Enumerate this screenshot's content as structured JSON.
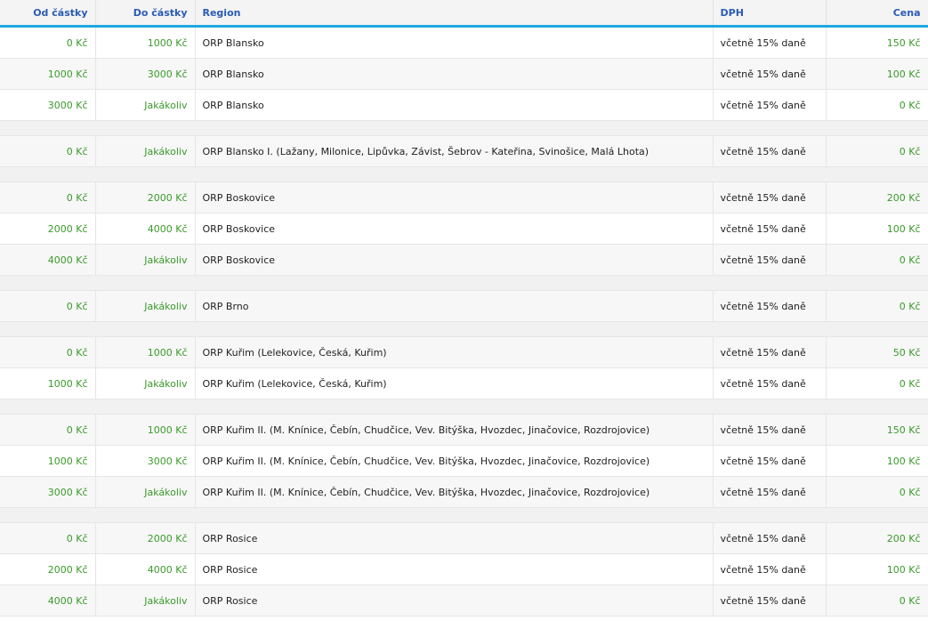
{
  "headers": [
    "Od částky",
    "Do částky",
    "Region",
    "DPH",
    "Cena"
  ],
  "rows": [
    {
      "from": "0 Kč",
      "to": "1000 Kč",
      "region": "ORP Blansko",
      "vat": "včetně 15% daně",
      "price": "150 Kč"
    },
    {
      "from": "1000 Kč",
      "to": "3000 Kč",
      "region": "ORP Blansko",
      "vat": "včetně 15% daně",
      "price": "100 Kč"
    },
    {
      "from": "3000 Kč",
      "to": "Jakákoliv",
      "region": "ORP Blansko",
      "vat": "včetně 15% daně",
      "price": "0 Kč"
    },
    {
      "separator": true
    },
    {
      "from": "0 Kč",
      "to": "Jakákoliv",
      "region": "ORP Blansko I. (Lažany, Milonice, Lipůvka, Závist, Šebrov - Kateřina, Svinošice, Malá Lhota)",
      "vat": "včetně 15% daně",
      "price": "0 Kč"
    },
    {
      "separator": true
    },
    {
      "from": "0 Kč",
      "to": "2000 Kč",
      "region": "ORP Boskovice",
      "vat": "včetně 15% daně",
      "price": "200 Kč"
    },
    {
      "from": "2000 Kč",
      "to": "4000 Kč",
      "region": "ORP Boskovice",
      "vat": "včetně 15% daně",
      "price": "100 Kč"
    },
    {
      "from": "4000 Kč",
      "to": "Jakákoliv",
      "region": "ORP Boskovice",
      "vat": "včetně 15% daně",
      "price": "0 Kč"
    },
    {
      "separator": true
    },
    {
      "from": "0 Kč",
      "to": "Jakákoliv",
      "region": "ORP Brno",
      "vat": "včetně 15% daně",
      "price": "0 Kč"
    },
    {
      "separator": true
    },
    {
      "from": "0 Kč",
      "to": "1000 Kč",
      "region": "ORP Kuřim (Lelekovice, Česká, Kuřim)",
      "vat": "včetně 15% daně",
      "price": "50 Kč"
    },
    {
      "from": "1000 Kč",
      "to": "Jakákoliv",
      "region": "ORP Kuřim (Lelekovice, Česká, Kuřim)",
      "vat": "včetně 15% daně",
      "price": "0 Kč"
    },
    {
      "separator": true
    },
    {
      "from": "0 Kč",
      "to": "1000 Kč",
      "region": "ORP Kuřim II. (M. Knínice, Čebín, Chudčice, Vev. Bitýška, Hvozdec, Jinačovice, Rozdrojovice)",
      "vat": "včetně 15% daně",
      "price": "150 Kč"
    },
    {
      "from": "1000 Kč",
      "to": "3000 Kč",
      "region": "ORP Kuřim II. (M. Knínice, Čebín, Chudčice, Vev. Bitýška, Hvozdec, Jinačovice, Rozdrojovice)",
      "vat": "včetně 15% daně",
      "price": "100 Kč"
    },
    {
      "from": "3000 Kč",
      "to": "Jakákoliv",
      "region": "ORP Kuřim II. (M. Knínice, Čebín, Chudčice, Vev. Bitýška, Hvozdec, Jinačovice, Rozdrojovice)",
      "vat": "včetně 15% daně",
      "price": "0 Kč"
    },
    {
      "separator": true
    },
    {
      "from": "0 Kč",
      "to": "2000 Kč",
      "region": "ORP Rosice",
      "vat": "včetně 15% daně",
      "price": "200 Kč"
    },
    {
      "from": "2000 Kč",
      "to": "4000 Kč",
      "region": "ORP Rosice",
      "vat": "včetně 15% daně",
      "price": "100 Kč"
    },
    {
      "from": "4000 Kč",
      "to": "Jakákoliv",
      "region": "ORP Rosice",
      "vat": "včetně 15% daně",
      "price": "0 Kč"
    }
  ]
}
